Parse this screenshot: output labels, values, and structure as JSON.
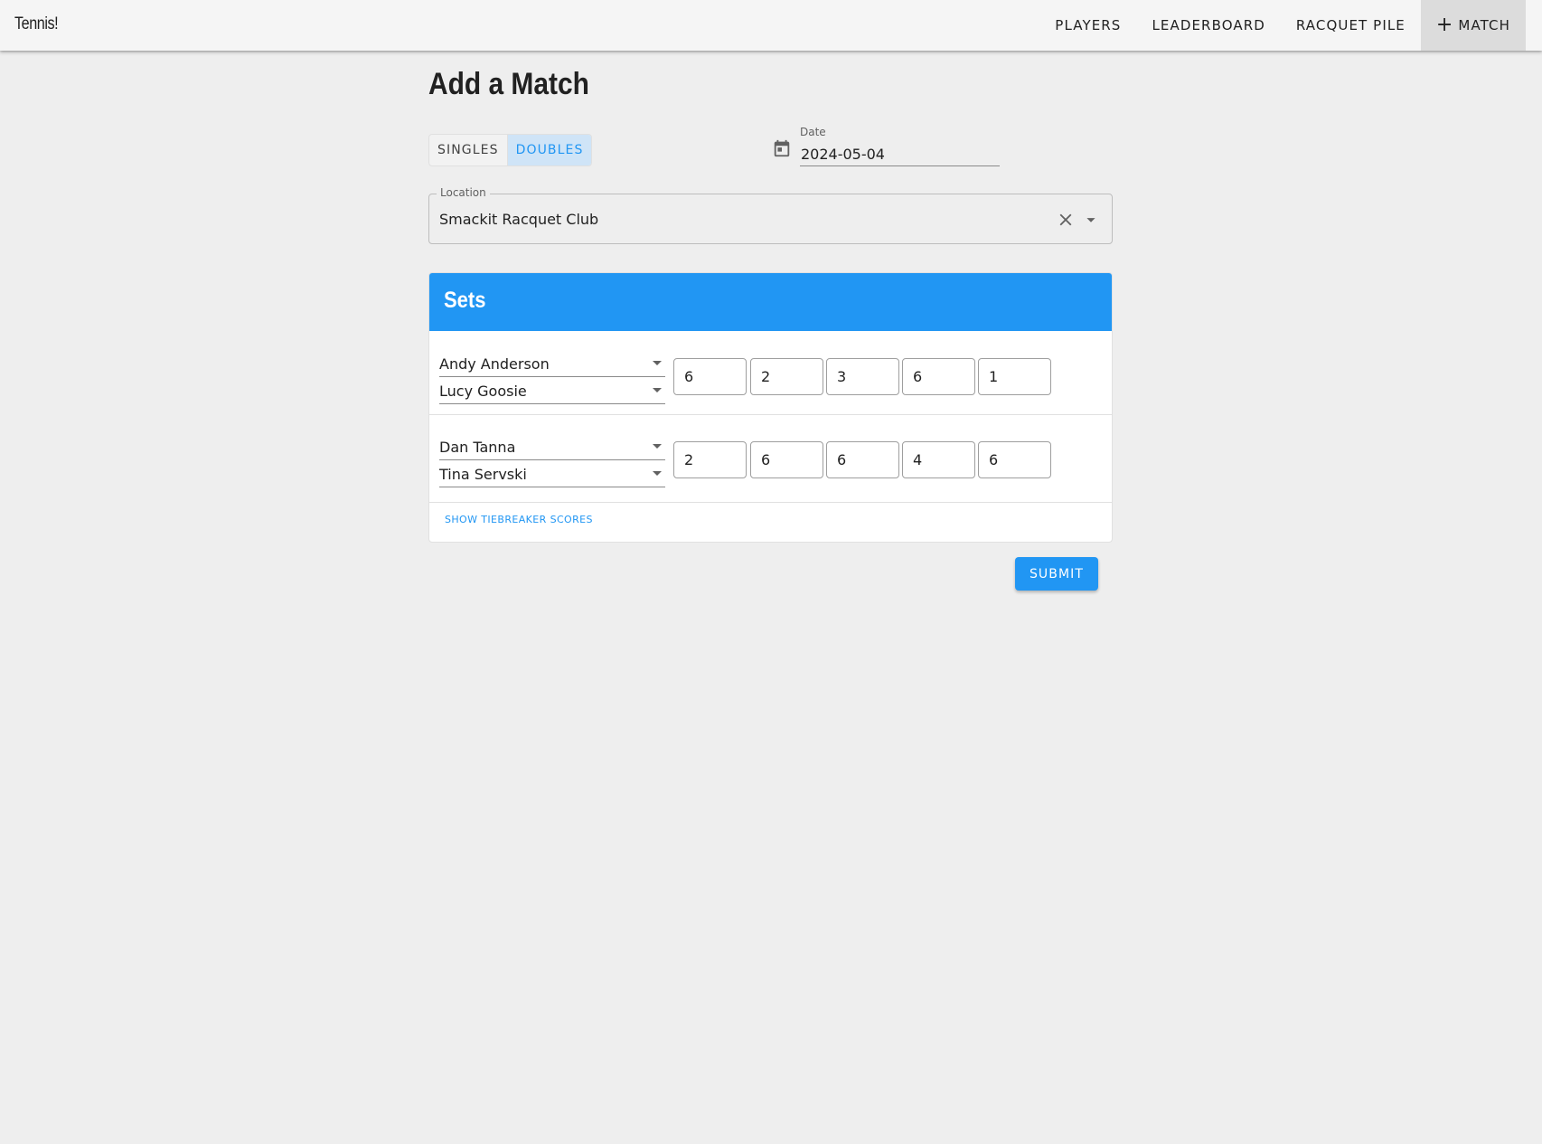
{
  "app": {
    "title": "Tennis!"
  },
  "nav": {
    "players": "PLAYERS",
    "leaderboard": "LEADERBOARD",
    "racquet_pile": "RACQUET PILE",
    "add_match_icon": "+",
    "add_match": "MATCH"
  },
  "page": {
    "title": "Add a Match"
  },
  "match_type": {
    "singles": "SINGLES",
    "doubles": "DOUBLES",
    "selected": "DOUBLES"
  },
  "date": {
    "label": "Date",
    "value": "2024-05-04",
    "icon": "calendar-icon"
  },
  "location": {
    "label": "Location",
    "value": "Smackit Racquet Club"
  },
  "sets": {
    "title": "Sets",
    "teams": [
      {
        "players": [
          "Andy Anderson",
          "Lucy Goosie"
        ],
        "scores": [
          "6",
          "2",
          "3",
          "6",
          "1"
        ]
      },
      {
        "players": [
          "Dan Tanna",
          "Tina Servski"
        ],
        "scores": [
          "2",
          "6",
          "6",
          "4",
          "6"
        ]
      }
    ],
    "tiebreak_label": "SHOW TIEBREAKER SCORES"
  },
  "actions": {
    "submit": "SUBMIT"
  },
  "colors": {
    "accent": "#2196f3",
    "appbar": "#f5f5f5",
    "background": "#eeeeee"
  }
}
